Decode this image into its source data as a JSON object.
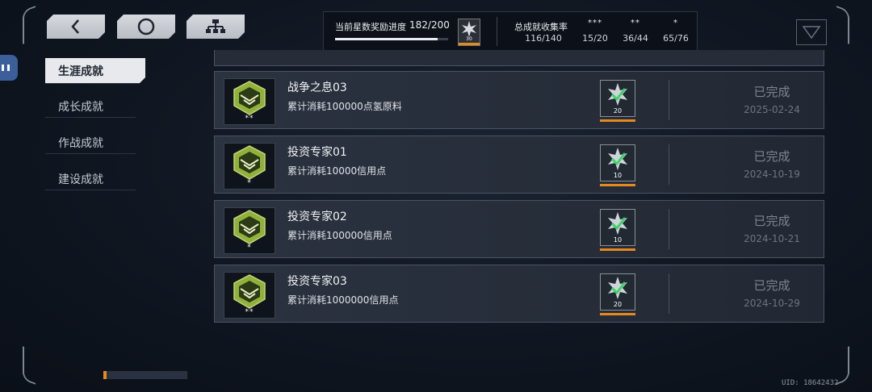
{
  "top_progress": {
    "star_label": "当前星数奖励进度",
    "star_value": "182/200",
    "star_fraction": 0.91,
    "reward_amount": "30",
    "total_label": "总成就收集率",
    "columns": [
      {
        "stars": "",
        "value": "116/140"
      },
      {
        "stars": "***",
        "value": "15/20"
      },
      {
        "stars": "**",
        "value": "36/44"
      },
      {
        "stars": "*",
        "value": "65/76"
      }
    ]
  },
  "nav": {
    "items": [
      {
        "label": "生涯成就"
      },
      {
        "label": "成长成就"
      },
      {
        "label": "作战成就"
      },
      {
        "label": "建设成就"
      }
    ]
  },
  "achievements": [
    {
      "title": "战争之息03",
      "desc": "累计消耗100000点氢原料",
      "stars": "**",
      "reward": "20",
      "status": "已完成",
      "date": "2025-02-24"
    },
    {
      "title": "投资专家01",
      "desc": "累计消耗10000信用点",
      "stars": "*",
      "reward": "10",
      "status": "已完成",
      "date": "2024-10-19"
    },
    {
      "title": "投资专家02",
      "desc": "累计消耗100000信用点",
      "stars": "*",
      "reward": "10",
      "status": "已完成",
      "date": "2024-10-21"
    },
    {
      "title": "投资专家03",
      "desc": "累计消耗1000000信用点",
      "stars": "**",
      "reward": "20",
      "status": "已完成",
      "date": "2024-10-29"
    }
  ],
  "uid": "UID: 18642432",
  "colors": {
    "accent": "#e48a1e",
    "medal_green": "#8fb33a",
    "check_green": "#3ed36a"
  }
}
